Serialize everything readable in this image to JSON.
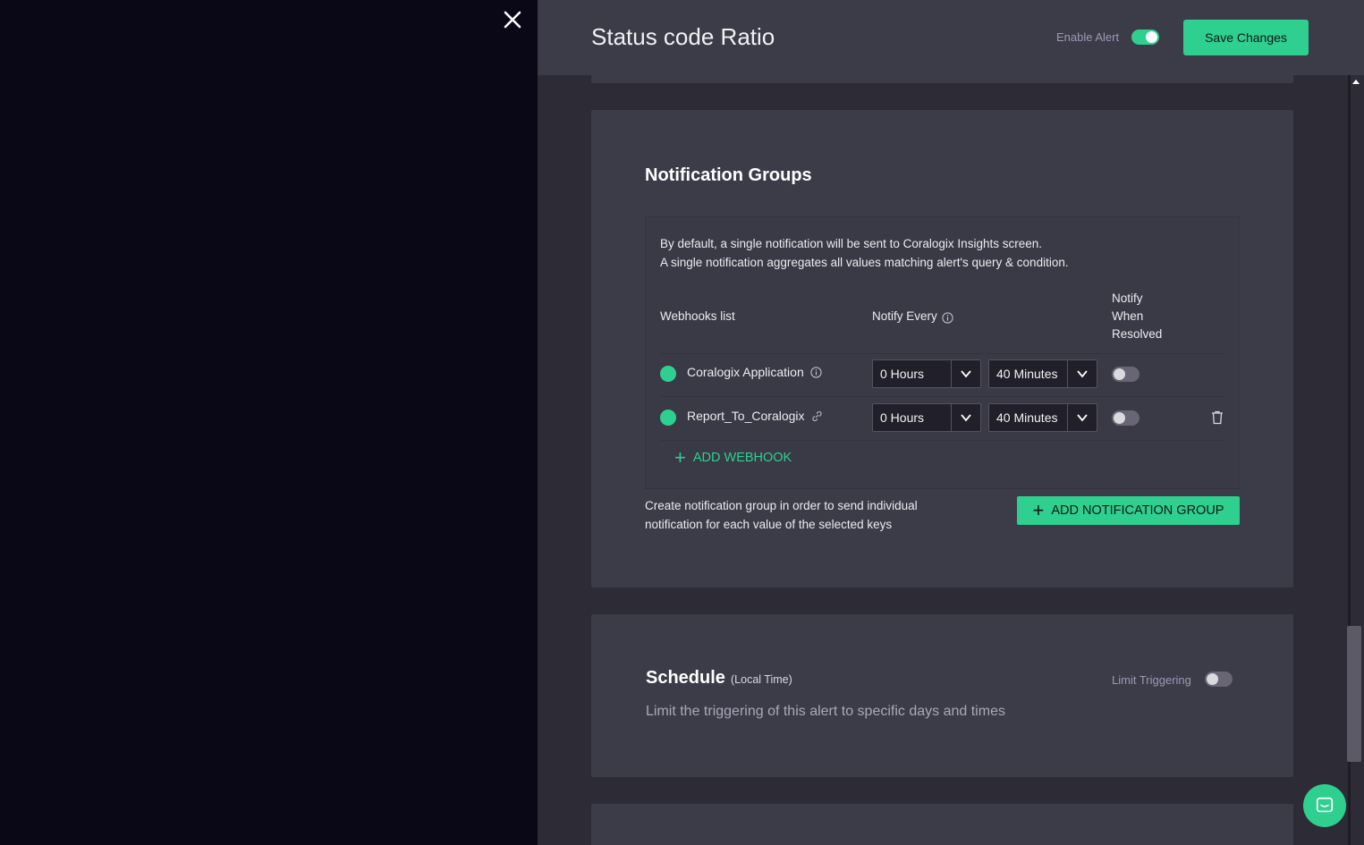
{
  "header": {
    "title": "Status code Ratio",
    "enable_alert_label": "Enable Alert",
    "enable_alert_on": true,
    "save_label": "Save Changes"
  },
  "notification_groups": {
    "title": "Notification Groups",
    "description_line1": "By default, a single notification will be sent to Coralogix Insights screen.",
    "description_line2": "A single notification aggregates all values matching alert's query & condition.",
    "columns": {
      "webhooks": "Webhooks list",
      "notify_every": "Notify Every",
      "notify_resolved_1": "Notify",
      "notify_resolved_2": "When",
      "notify_resolved_3": "Resolved"
    },
    "webhooks": [
      {
        "name": "Coralogix Application",
        "hours": "0 Hours",
        "minutes": "40 Minutes",
        "notify_resolved": false
      },
      {
        "name": "Report_To_Coralogix",
        "hours": "0 Hours",
        "minutes": "40 Minutes",
        "notify_resolved": false
      }
    ],
    "add_webhook_label": "ADD WEBHOOK",
    "help_text": "Create notification group in order to send individual notification for each value of the selected keys",
    "add_group_label": "ADD NOTIFICATION GROUP"
  },
  "schedule": {
    "title": "Schedule",
    "subtitle": "(Local Time)",
    "description": "Limit the triggering of this alert to specific days and times",
    "limit_label": "Limit Triggering",
    "limit_on": false
  },
  "colors": {
    "accent": "#2fcf90",
    "panel": "#3c3b48",
    "backdrop": "#0a0817"
  },
  "icons": [
    "close-icon",
    "info-icon",
    "link-icon",
    "chevron-down-icon",
    "trash-icon",
    "plus-icon",
    "chat-icon"
  ]
}
